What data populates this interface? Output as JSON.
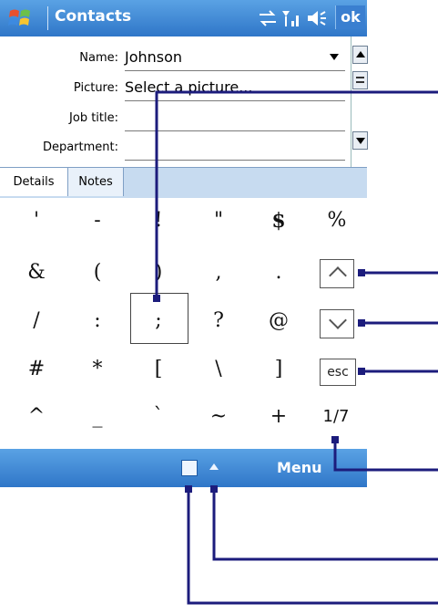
{
  "app": {
    "title": "Contacts",
    "ok_label": "ok"
  },
  "status_icons": [
    "sync-icon",
    "signal-icon",
    "speaker-icon"
  ],
  "form": {
    "fields": [
      {
        "label": "Name:",
        "value": "Johnson",
        "has_dropdown": true
      },
      {
        "label": "Picture:",
        "value": "Select a picture..."
      },
      {
        "label": "Job title:",
        "value": ""
      },
      {
        "label": "Department:",
        "value": ""
      }
    ]
  },
  "tabs": [
    {
      "label": "Details",
      "selected": true
    },
    {
      "label": "Notes",
      "selected": false
    }
  ],
  "keyboard": {
    "rows": [
      [
        "'",
        "-",
        "!",
        "\"",
        "$",
        "%"
      ],
      [
        "&",
        "(",
        ")",
        ",",
        ".",
        ""
      ],
      [
        "/",
        ":",
        ";",
        "?",
        "@",
        ""
      ],
      [
        "#",
        "*",
        "[",
        "\\",
        "]",
        ""
      ],
      [
        "^",
        "_",
        "`",
        "~",
        "+",
        ""
      ]
    ],
    "esc_label": "esc",
    "page_label": "1/7"
  },
  "bottom_bar": {
    "menu_label": "Menu"
  },
  "colors": {
    "bar_blue": "#2f76c8",
    "callout_line": "#1c1c7c"
  }
}
